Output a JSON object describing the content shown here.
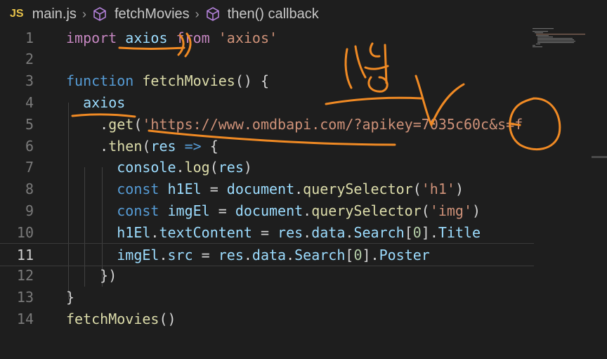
{
  "breadcrumb": {
    "file_icon": "JS",
    "file": "main.js",
    "symbol1": "fetchMovies",
    "symbol2": "then() callback"
  },
  "editor": {
    "current_line": 11,
    "lines": [
      {
        "n": "1",
        "tokens": [
          [
            "import ",
            "kw"
          ],
          [
            "axios",
            "var"
          ],
          [
            " from ",
            "kw"
          ],
          [
            "'axios'",
            "str"
          ]
        ]
      },
      {
        "n": "2",
        "tokens": []
      },
      {
        "n": "3",
        "tokens": [
          [
            "function ",
            "kw2"
          ],
          [
            "fetchMovies",
            "fn"
          ],
          [
            "() {",
            "plain"
          ]
        ]
      },
      {
        "n": "4",
        "tokens": [
          [
            "  axios",
            "var"
          ]
        ]
      },
      {
        "n": "5",
        "tokens": [
          [
            "    .",
            "plain"
          ],
          [
            "get",
            "fn"
          ],
          [
            "(",
            "plain"
          ],
          [
            "'https://www.omdbapi.com/?apikey=7035c60c&s=f",
            "str"
          ]
        ]
      },
      {
        "n": "6",
        "tokens": [
          [
            "    .",
            "plain"
          ],
          [
            "then",
            "fn"
          ],
          [
            "(",
            "plain"
          ],
          [
            "res",
            "var"
          ],
          [
            " => ",
            "kw2"
          ],
          [
            "{",
            "plain"
          ]
        ]
      },
      {
        "n": "7",
        "tokens": [
          [
            "      console",
            "var"
          ],
          [
            ".",
            "plain"
          ],
          [
            "log",
            "fn"
          ],
          [
            "(",
            "plain"
          ],
          [
            "res",
            "var"
          ],
          [
            ")",
            "plain"
          ]
        ]
      },
      {
        "n": "8",
        "tokens": [
          [
            "      const ",
            "kw2"
          ],
          [
            "h1El",
            "var"
          ],
          [
            " = ",
            "plain"
          ],
          [
            "document",
            "var"
          ],
          [
            ".",
            "plain"
          ],
          [
            "querySelector",
            "fn"
          ],
          [
            "(",
            "plain"
          ],
          [
            "'h1'",
            "str"
          ],
          [
            ")",
            "plain"
          ]
        ]
      },
      {
        "n": "9",
        "tokens": [
          [
            "      const ",
            "kw2"
          ],
          [
            "imgEl",
            "var"
          ],
          [
            " = ",
            "plain"
          ],
          [
            "document",
            "var"
          ],
          [
            ".",
            "plain"
          ],
          [
            "querySelector",
            "fn"
          ],
          [
            "(",
            "plain"
          ],
          [
            "'img'",
            "str"
          ],
          [
            ")",
            "plain"
          ]
        ]
      },
      {
        "n": "10",
        "tokens": [
          [
            "      h1El",
            "var"
          ],
          [
            ".",
            "plain"
          ],
          [
            "textContent",
            "prop"
          ],
          [
            " = ",
            "plain"
          ],
          [
            "res",
            "var"
          ],
          [
            ".",
            "plain"
          ],
          [
            "data",
            "prop"
          ],
          [
            ".",
            "plain"
          ],
          [
            "Search",
            "prop"
          ],
          [
            "[",
            "plain"
          ],
          [
            "0",
            "num"
          ],
          [
            "].",
            "plain"
          ],
          [
            "Title",
            "prop"
          ]
        ]
      },
      {
        "n": "11",
        "tokens": [
          [
            "      imgEl",
            "var"
          ],
          [
            ".",
            "plain"
          ],
          [
            "src",
            "prop"
          ],
          [
            " = ",
            "plain"
          ],
          [
            "res",
            "var"
          ],
          [
            ".",
            "plain"
          ],
          [
            "data",
            "prop"
          ],
          [
            ".",
            "plain"
          ],
          [
            "Search",
            "prop"
          ],
          [
            "[",
            "plain"
          ],
          [
            "0",
            "num"
          ],
          [
            "].",
            "plain"
          ],
          [
            "Poster",
            "prop"
          ]
        ]
      },
      {
        "n": "12",
        "tokens": [
          [
            "    }",
            "plain"
          ],
          [
            ")",
            "plain"
          ]
        ]
      },
      {
        "n": "13",
        "tokens": [
          [
            "}",
            "plain"
          ]
        ]
      },
      {
        "n": "14",
        "tokens": [
          [
            "fetchMovies",
            "fn"
          ],
          [
            "()",
            "plain"
          ]
        ]
      }
    ]
  },
  "annotations": {
    "handwritten_text": "ㅂ생",
    "color": "#f08a24"
  }
}
